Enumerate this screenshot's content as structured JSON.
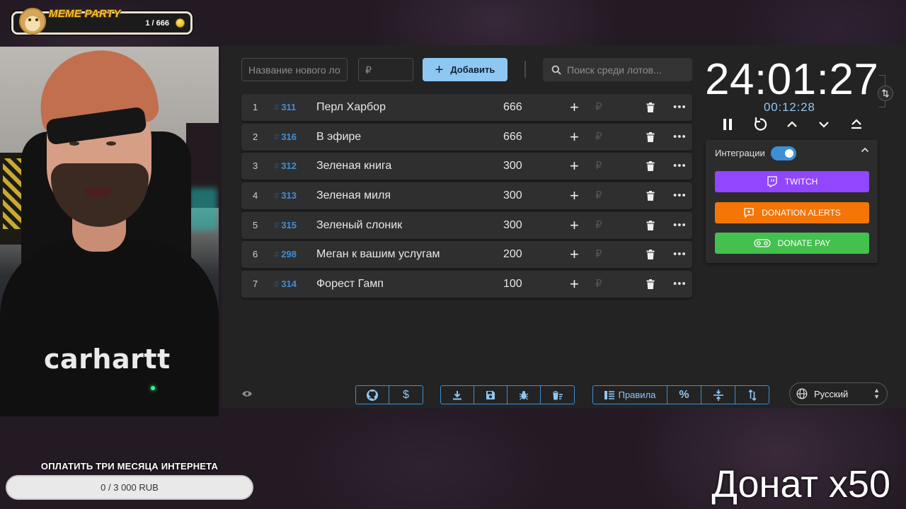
{
  "overlay": {
    "meme_party": {
      "title": "MEME PARTY",
      "count": "1 / 666"
    },
    "goal": {
      "title": "ОПЛАТИТЬ ТРИ МЕСЯЦА ИНТЕРНЕТА",
      "progress_text": "0 / 3 000 RUB",
      "progress": 0
    },
    "donat_caption": "Донат x50",
    "webcam": {
      "shirt_text": "carhartt"
    }
  },
  "form": {
    "name_placeholder": "Название нового лот",
    "price_placeholder": "₽",
    "add_label": "Добавить",
    "search_placeholder": "Поиск среди лотов..."
  },
  "lots": [
    {
      "num": "1",
      "id": "311",
      "name": "Перл Харбор",
      "amount": "666"
    },
    {
      "num": "2",
      "id": "316",
      "name": "В эфире",
      "amount": "666"
    },
    {
      "num": "3",
      "id": "312",
      "name": "Зеленая книга",
      "amount": "300"
    },
    {
      "num": "4",
      "id": "313",
      "name": "Зеленая миля",
      "amount": "300"
    },
    {
      "num": "5",
      "id": "315",
      "name": "Зеленый слоник",
      "amount": "300"
    },
    {
      "num": "6",
      "id": "298",
      "name": "Меган к вашим услугам",
      "amount": "200"
    },
    {
      "num": "7",
      "id": "314",
      "name": "Форест Гамп",
      "amount": "100"
    }
  ],
  "lot_symbols": {
    "hash": "#",
    "plus": "+",
    "rub": "₽",
    "more": "•••"
  },
  "timer": {
    "main": "24:01:27",
    "sub": "00:12:28"
  },
  "integrations": {
    "label": "Интеграции",
    "enabled": true,
    "twitch": "TWITCH",
    "donation_alerts": "DONATION ALERTS",
    "donate_pay": "DONATE PAY"
  },
  "toolbar": {
    "rules_label": "Правила",
    "percent_label": "%",
    "dollar_label": "$"
  },
  "language": {
    "selected": "Русский"
  },
  "colors": {
    "accent": "#3d8fd6",
    "add_button": "#8fc7f3",
    "twitch": "#9146ff",
    "donation_alerts": "#f57507",
    "donate_pay": "#43c04e"
  }
}
